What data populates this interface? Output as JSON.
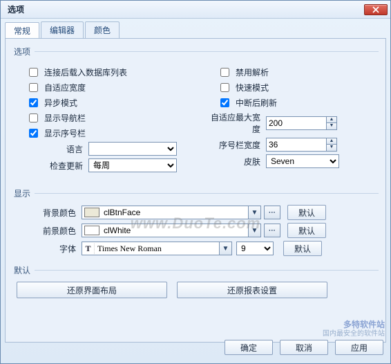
{
  "window": {
    "title": "选项"
  },
  "tabs": {
    "general": "常规",
    "editor": "编辑器",
    "color": "颜色"
  },
  "groups": {
    "options": "选项",
    "display": "显示",
    "default": "默认"
  },
  "options_left": {
    "load_db_list": {
      "label": "连接后载入数据库列表",
      "checked": false
    },
    "auto_width": {
      "label": "自适应宽度",
      "checked": false
    },
    "async_mode": {
      "label": "异步模式",
      "checked": true
    },
    "show_nav": {
      "label": "显示导航栏",
      "checked": false
    },
    "show_rownum": {
      "label": "显示序号栏",
      "checked": true
    }
  },
  "options_right": {
    "disable_parse": {
      "label": "禁用解析",
      "checked": false
    },
    "fast_mode": {
      "label": "快速模式",
      "checked": false
    },
    "refresh_on_break": {
      "label": "中断后刷新",
      "checked": true
    },
    "max_auto_width": {
      "label": "自适应最大宽度",
      "value": "200"
    },
    "rownum_width": {
      "label": "序号栏宽度",
      "value": "36"
    }
  },
  "misc": {
    "language_label": "语言",
    "language_value": "",
    "check_update_label": "检查更新",
    "check_update_value": "每周",
    "skin_label": "皮肤",
    "skin_value": "Seven"
  },
  "display": {
    "bgcolor_label": "背景颜色",
    "bgcolor_value": "clBtnFace",
    "bgcolor_swatch": "#ece9d8",
    "fgcolor_label": "前景颜色",
    "fgcolor_value": "clWhite",
    "fgcolor_swatch": "#ffffff",
    "font_label": "字体",
    "font_name": "Times New Roman",
    "font_size": "9",
    "default_btn": "默认"
  },
  "defaults": {
    "restore_layout": "还原界面布局",
    "restore_report": "还原报表设置"
  },
  "footer": {
    "ok": "确定",
    "cancel": "取消",
    "apply": "应用"
  },
  "watermark": "www.DuoTe.com",
  "badge": {
    "line1": "多特软件站",
    "line2": "国内最安全的软件站"
  }
}
